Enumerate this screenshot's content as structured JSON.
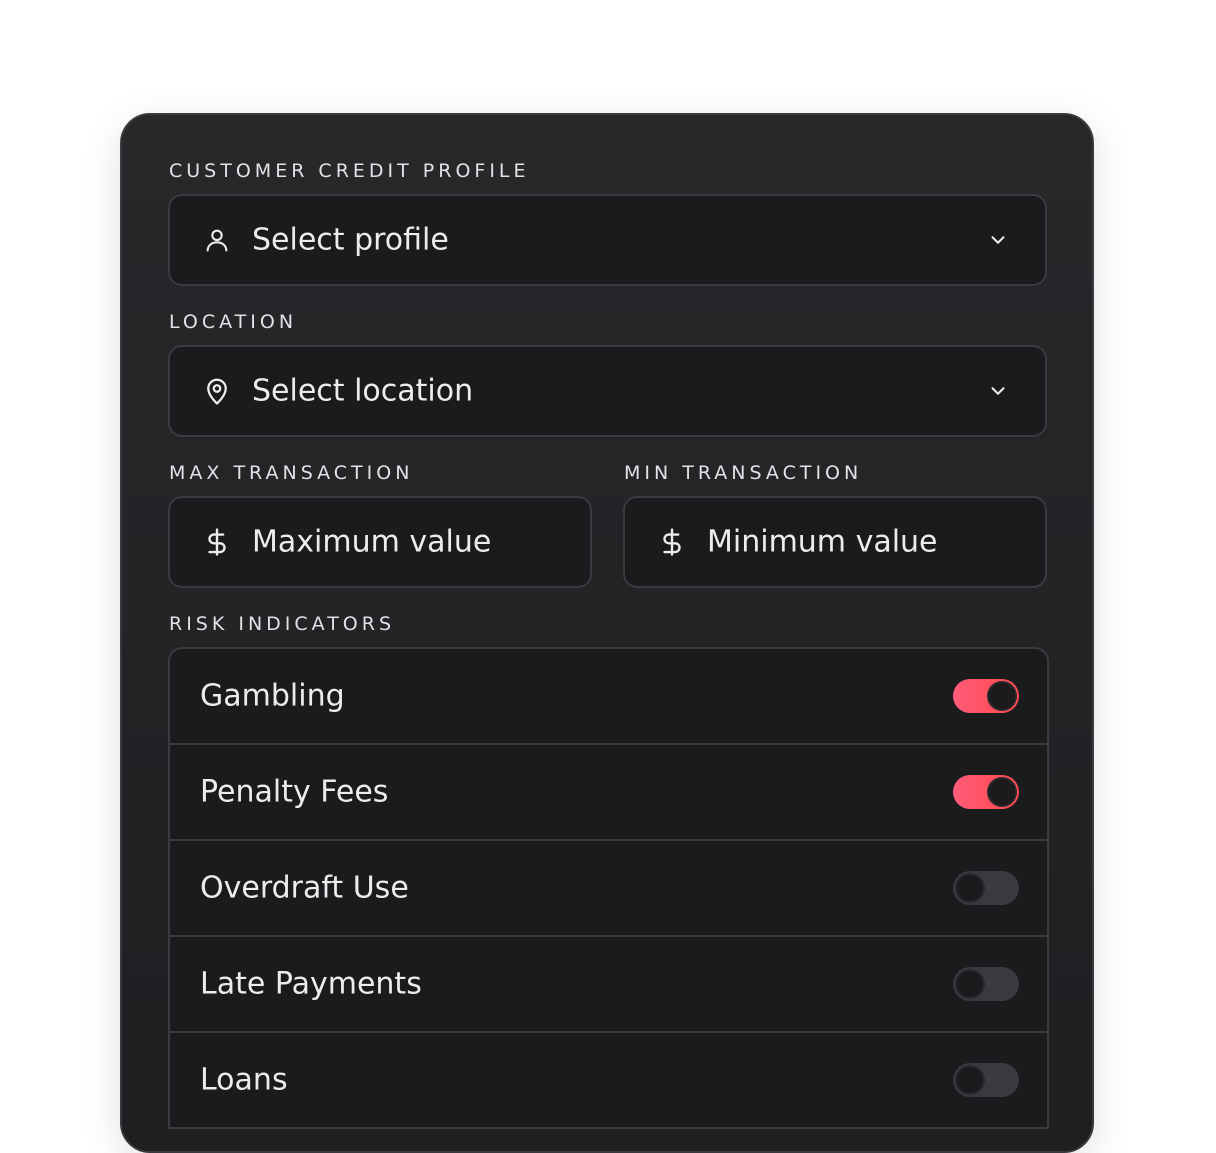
{
  "profile": {
    "label": "CUSTOMER CREDIT PROFILE",
    "value": "Select profile",
    "icon": "user-icon"
  },
  "location": {
    "label": "LOCATION",
    "value": "Select location",
    "icon": "map-pin-icon"
  },
  "max_transaction": {
    "label": "MAX TRANSACTION",
    "placeholder": "Maximum value",
    "icon": "dollar-icon"
  },
  "min_transaction": {
    "label": "MIN TRANSACTION",
    "placeholder": "Minimum value",
    "icon": "dollar-icon"
  },
  "risk": {
    "label": "RISK INDICATORS",
    "items": [
      {
        "label": "Gambling",
        "enabled": true
      },
      {
        "label": "Penalty Fees",
        "enabled": true
      },
      {
        "label": "Overdraft Use",
        "enabled": false
      },
      {
        "label": "Late Payments",
        "enabled": false
      },
      {
        "label": "Loans",
        "enabled": false
      }
    ]
  },
  "colors": {
    "panel_bg": "#1f1f22",
    "toggle_on_start": "#ff5b7a",
    "toggle_on_end": "#ff4a4a",
    "toggle_off": "#3a3a40"
  }
}
